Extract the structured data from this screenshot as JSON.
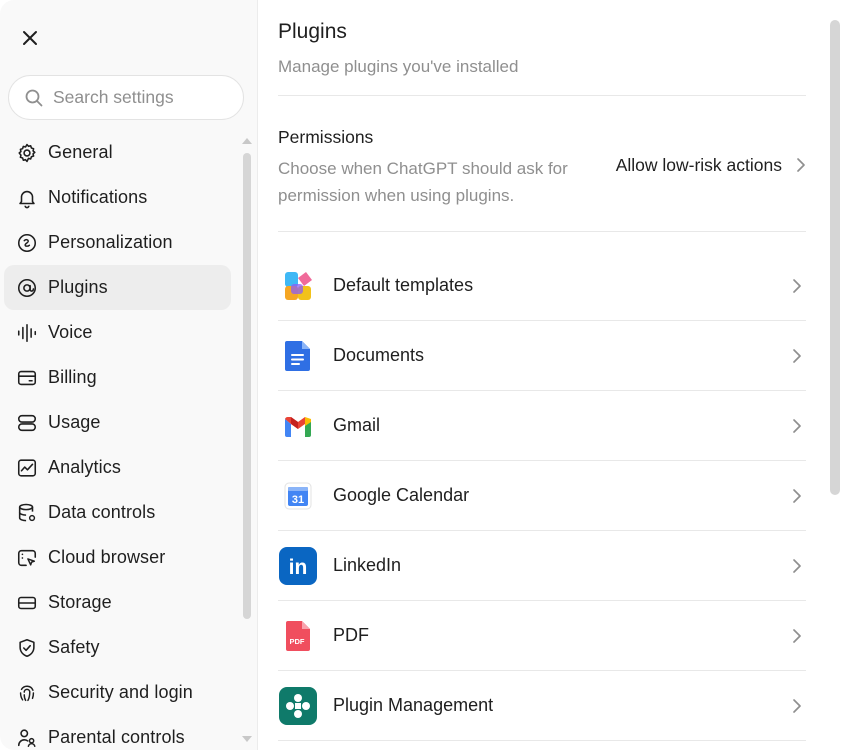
{
  "sidebar": {
    "search_placeholder": "Search settings",
    "items": [
      {
        "label": "General",
        "icon": "gear-icon"
      },
      {
        "label": "Notifications",
        "icon": "bell-icon"
      },
      {
        "label": "Personalization",
        "icon": "personalization-icon"
      },
      {
        "label": "Plugins",
        "icon": "plugin-icon",
        "active": true
      },
      {
        "label": "Voice",
        "icon": "voice-icon"
      },
      {
        "label": "Billing",
        "icon": "card-icon"
      },
      {
        "label": "Usage",
        "icon": "usage-icon"
      },
      {
        "label": "Analytics",
        "icon": "analytics-icon"
      },
      {
        "label": "Data controls",
        "icon": "database-icon"
      },
      {
        "label": "Cloud browser",
        "icon": "cloud-browser-icon"
      },
      {
        "label": "Storage",
        "icon": "storage-icon"
      },
      {
        "label": "Safety",
        "icon": "shield-icon"
      },
      {
        "label": "Security and login",
        "icon": "fingerprint-icon"
      },
      {
        "label": "Parental controls",
        "icon": "parental-icon"
      }
    ]
  },
  "main": {
    "title": "Plugins",
    "subtitle": "Manage plugins you've installed",
    "permissions": {
      "title": "Permissions",
      "description": "Choose when ChatGPT should ask for permission when using plugins.",
      "value": "Allow low-risk actions"
    },
    "plugins": [
      {
        "name": "Default templates",
        "icon": "default-templates-icon"
      },
      {
        "name": "Documents",
        "icon": "documents-icon"
      },
      {
        "name": "Gmail",
        "icon": "gmail-icon"
      },
      {
        "name": "Google Calendar",
        "icon": "google-calendar-icon",
        "icon_text": "31"
      },
      {
        "name": "LinkedIn",
        "icon": "linkedin-icon",
        "icon_text": "in"
      },
      {
        "name": "PDF",
        "icon": "pdf-icon",
        "icon_text": "PDF"
      },
      {
        "name": "Plugin Management",
        "icon": "plugin-management-icon"
      }
    ]
  },
  "colors": {
    "sidebar_bg": "#f9f9f9",
    "active_item_bg": "#ededed",
    "muted_text": "#8f8f8f",
    "divider": "#e8e8e8",
    "linkedin_blue": "#0a66c2",
    "plugin_mgmt_teal": "#0f7a6a",
    "docs_blue": "#2f6fe4"
  }
}
